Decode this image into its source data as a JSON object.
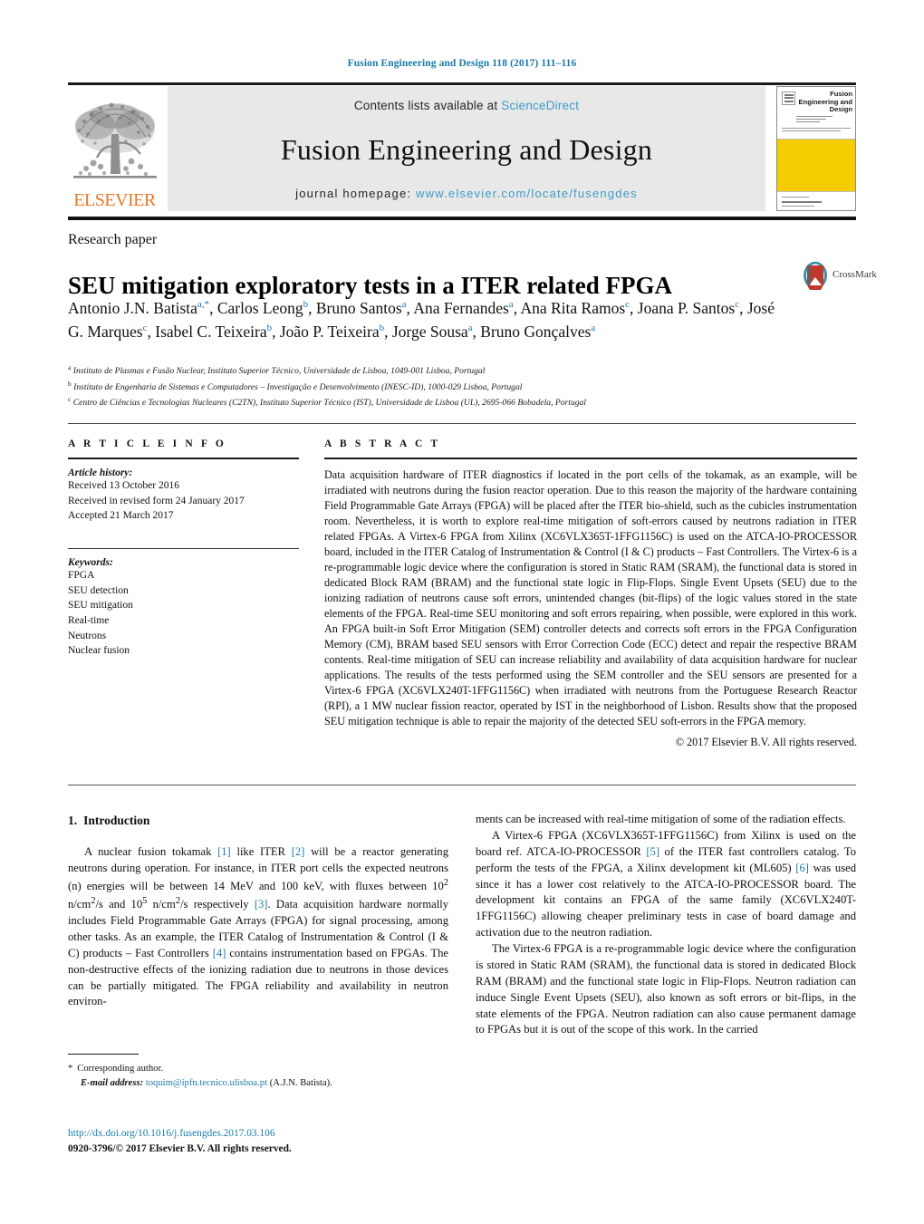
{
  "running_head": "Fusion Engineering and Design 118 (2017) 111–116",
  "masthead": {
    "publisher_wordmark": "ELSEVIER",
    "contents_prefix": "Contents lists available at ",
    "contents_link": "ScienceDirect",
    "journal_title": "Fusion Engineering and Design",
    "homepage_prefix": "journal homepage: ",
    "homepage_link": "www.elsevier.com/locate/fusengdes",
    "cover_title": "Fusion Engineering and Design"
  },
  "article": {
    "doctype": "Research paper",
    "title": "SEU mitigation exploratory tests in a ITER related FPGA",
    "crossmark_label": "CrossMark",
    "authors_html": "Antonio J.N. Batista<sup>a,*</sup>, Carlos Leong<sup>b</sup>, Bruno Santos<sup>a</sup>, Ana Fernandes<sup>a</sup>, Ana Rita Ramos<sup>c</sup>, Joana P. Santos<sup>c</sup>, José G. Marques<sup>c</sup>, Isabel C. Teixeira<sup>b</sup>, João P. Teixeira<sup>b</sup>, Jorge Sousa<sup>a</sup>, Bruno Gonçalves<sup>a</sup>",
    "affiliations": [
      {
        "mark": "a",
        "text": "Instituto de Plasmas e Fusão Nuclear, Instituto Superior Técnico, Universidade de Lisboa, 1049-001 Lisboa, Portugal"
      },
      {
        "mark": "b",
        "text": "Instituto de Engenharia de Sistemas e Computadores – Investigação e Desenvolvimento (INESC-ID), 1000-029 Lisboa, Portugal"
      },
      {
        "mark": "c",
        "text": "Centro de Ciências e Tecnologias Nucleares (C2TN), Instituto Superior Técnico (IST), Universidade de Lisboa (UL), 2695-066 Bobadela, Portugal"
      }
    ]
  },
  "article_info": {
    "heading": "A R T I C L E   I N F O",
    "history_label": "Article history:",
    "history": [
      "Received 13 October 2016",
      "Received in revised form 24 January 2017",
      "Accepted 21 March 2017"
    ],
    "keywords_label": "Keywords:",
    "keywords": [
      "FPGA",
      "SEU detection",
      "SEU mitigation",
      "Real-time",
      "Neutrons",
      "Nuclear fusion"
    ]
  },
  "abstract": {
    "heading": "A B S T R A C T",
    "text": "Data acquisition hardware of ITER diagnostics if located in the port cells of the tokamak, as an example, will be irradiated with neutrons during the fusion reactor operation. Due to this reason the majority of the hardware containing Field Programmable Gate Arrays (FPGA) will be placed after the ITER bio-shield, such as the cubicles instrumentation room. Nevertheless, it is worth to explore real-time mitigation of soft-errors caused by neutrons radiation in ITER related FPGAs. A Virtex-6 FPGA from Xilinx (XC6VLX365T-1FFG1156C) is used on the ATCA-IO-PROCESSOR board, included in the ITER Catalog of Instrumentation & Control (I & C) products – Fast Controllers. The Virtex-6 is a re-programmable logic device where the configuration is stored in Static RAM (SRAM), the functional data is stored in dedicated Block RAM (BRAM) and the functional state logic in Flip-Flops. Single Event Upsets (SEU) due to the ionizing radiation of neutrons cause soft errors, unintended changes (bit-flips) of the logic values stored in the state elements of the FPGA. Real-time SEU monitoring and soft errors repairing, when possible, were explored in this work. An FPGA built-in Soft Error Mitigation (SEM) controller detects and corrects soft errors in the FPGA Configuration Memory (CM), BRAM based SEU sensors with Error Correction Code (ECC) detect and repair the respective BRAM contents. Real-time mitigation of SEU can increase reliability and availability of data acquisition hardware for nuclear applications. The results of the tests performed using the SEM controller and the SEU sensors are presented for a Virtex-6 FPGA (XC6VLX240T-1FFG1156C) when irradiated with neutrons from the Portuguese Research Reactor (RPI), a 1 MW nuclear fission reactor, operated by IST in the neighborhood of Lisbon. Results show that the proposed SEU mitigation technique is able to repair the majority of the detected SEU soft-errors in the FPGA memory.",
    "copyright": "© 2017 Elsevier B.V. All rights reserved."
  },
  "body": {
    "section_number": "1.",
    "section_title": "Introduction",
    "left_paragraph_1_pre": "A nuclear fusion tokamak ",
    "left_ref_1": "[1]",
    "left_paragraph_1_mid1": " like ITER ",
    "left_ref_2": "[2]",
    "left_paragraph_1_mid2": " will be a reactor generating neutrons during operation. For instance, in ITER port cells the expected neutrons (n) energies will be between 14 MeV and 100 keV, with fluxes between 10",
    "flux_exp_1": "2",
    "flux_unit_1": " n/cm",
    "flux_unit_sup_1": "2",
    "flux_mid": "/s and 10",
    "flux_exp_2": "5",
    "flux_unit_2": " n/cm",
    "flux_unit_sup_2": "2",
    "flux_tail": "/s respectively ",
    "left_ref_3": "[3]",
    "left_paragraph_1_post": ". Data acquisition hardware normally includes Field Programmable Gate Arrays (FPGA) for signal processing, among other tasks. As an example, the ITER Catalog of Instrumentation & Control (I & C) products – Fast Controllers ",
    "left_ref_4": "[4]",
    "left_paragraph_1_end": " contains instrumentation based on FPGAs. The non-destructive effects of the ionizing radiation due to neutrons in those devices can be partially mitigated. The FPGA reliability and availability in neutron environ-",
    "right_paragraph_1": "ments can be increased with real-time mitigation of some of the radiation effects.",
    "right_paragraph_2_pre": "A Virtex-6 FPGA (XC6VLX365T-1FFG1156C) from Xilinx is used on the board ref. ATCA-IO-PROCESSOR ",
    "right_ref_5": "[5]",
    "right_paragraph_2_mid": " of the ITER fast controllers catalog. To perform the tests of the FPGA, a Xilinx development kit (ML605) ",
    "right_ref_6": "[6]",
    "right_paragraph_2_post": " was used since it has a lower cost relatively to the ATCA-IO-PROCESSOR board. The development kit contains an FPGA of the same family (XC6VLX240T-1FFG1156C) allowing cheaper preliminary tests in case of board damage and activation due to the neutron radiation.",
    "right_paragraph_3": "The Virtex-6 FPGA is a re-programmable logic device where the configuration is stored in Static RAM (SRAM), the functional data is stored in dedicated Block RAM (BRAM) and the functional state logic in Flip-Flops. Neutron radiation can induce Single Event Upsets (SEU), also known as soft errors or bit-flips, in the state elements of the FPGA. Neutron radiation can also cause permanent damage to FPGAs but it is out of the scope of this work. In the carried"
  },
  "footer": {
    "corresponding_star": "*",
    "corresponding_label": "Corresponding author.",
    "email_label": "E-mail address:",
    "email": "toquim@ipfn.tecnico.ulisboa.pt",
    "email_suffix": "(A.J.N. Batista).",
    "doi": "http://dx.doi.org/10.1016/j.fusengdes.2017.03.106",
    "issn_line": "0920-3796/© 2017 Elsevier B.V. All rights reserved."
  },
  "colors": {
    "link_blue": "#1a7ba8",
    "masthead_link": "#3d9bc7",
    "elsevier_orange": "#e87722",
    "cover_yellow": "#f5cc00",
    "band_grey": "#e8e8e8"
  }
}
